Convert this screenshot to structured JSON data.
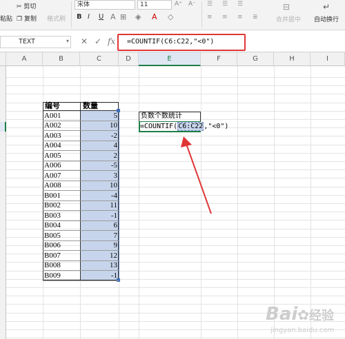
{
  "ribbon": {
    "paste_label": "粘贴",
    "cut_label": "剪切",
    "copy_label": "复制",
    "format_painter_label": "格式刷",
    "font_name": "宋体",
    "font_size": "11",
    "bold_label": "B",
    "italic_label": "I",
    "underline_label": "U",
    "merge_center_label": "合并居中",
    "wrap_text_label": "自动换行"
  },
  "formula_bar": {
    "name_box": "TEXT",
    "cancel_symbol": "✕",
    "confirm_symbol": "✓",
    "fx_label": "fx",
    "formula": "=COUNTIF(C6:C22,\"<0\")"
  },
  "columns": [
    "A",
    "B",
    "C",
    "D",
    "E",
    "F",
    "G",
    "H",
    "I"
  ],
  "table": {
    "header_id": "编号",
    "header_qty": "数量",
    "rows": [
      {
        "id": "A001",
        "qty": "5"
      },
      {
        "id": "A002",
        "qty": "10"
      },
      {
        "id": "A003",
        "qty": "-2"
      },
      {
        "id": "A004",
        "qty": "4"
      },
      {
        "id": "A005",
        "qty": "2"
      },
      {
        "id": "A006",
        "qty": "-5"
      },
      {
        "id": "A007",
        "qty": "3"
      },
      {
        "id": "A008",
        "qty": "10"
      },
      {
        "id": "B001",
        "qty": "-4"
      },
      {
        "id": "B002",
        "qty": "11"
      },
      {
        "id": "B003",
        "qty": "-1"
      },
      {
        "id": "B004",
        "qty": "6"
      },
      {
        "id": "B005",
        "qty": "7"
      },
      {
        "id": "B006",
        "qty": "9"
      },
      {
        "id": "B007",
        "qty": "12"
      },
      {
        "id": "B008",
        "qty": "13"
      },
      {
        "id": "B009",
        "qty": "-1"
      }
    ]
  },
  "stats": {
    "label": "负数个数统计",
    "formula_prefix": "=COUNTIF(",
    "formula_range": "C6:C22",
    "formula_suffix": ",\"<0\")"
  },
  "watermark": {
    "brand": "Bai",
    "brand2": "经验",
    "url": "jingyan.baidu.com"
  },
  "annotation_color": "#e03535",
  "selection_color": "#c7d5ec"
}
